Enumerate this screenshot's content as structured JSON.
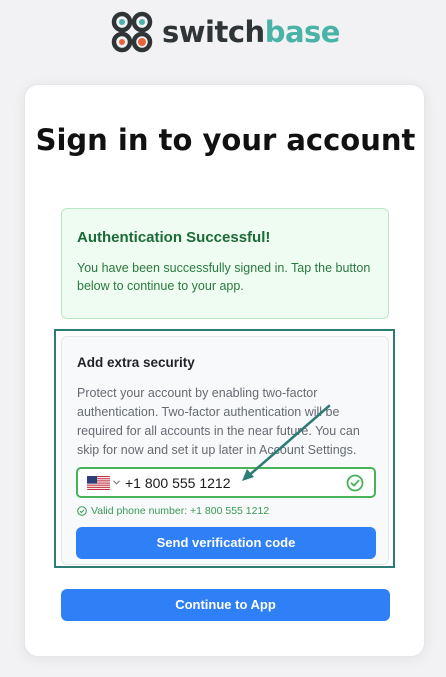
{
  "brand": {
    "name_part1": "switch",
    "name_part2": "base",
    "dark_color": "#2f3437",
    "teal_color": "#49b3a7",
    "dot_color": "#e8643a"
  },
  "page": {
    "title": "Sign in to your account"
  },
  "alert": {
    "title": "Authentication Successful!",
    "body": "You have been successfully signed in. Tap the button below to continue to your app."
  },
  "security": {
    "title": "Add extra security",
    "description": "Protect your account by enabling two-factor authentication. Two-factor authentication will be required for all accounts in the near future. You can skip for now and set it up later in Account Settings.",
    "country_icon": "us-flag-icon",
    "phone_value": "+1 800 555 1212",
    "valid_message": "Valid phone number: +1 800 555 1212",
    "send_button": "Send verification code"
  },
  "actions": {
    "continue_button": "Continue to App"
  },
  "colors": {
    "primary": "#2f7ff6",
    "success": "#49b35c",
    "highlight": "#2d7d76"
  }
}
